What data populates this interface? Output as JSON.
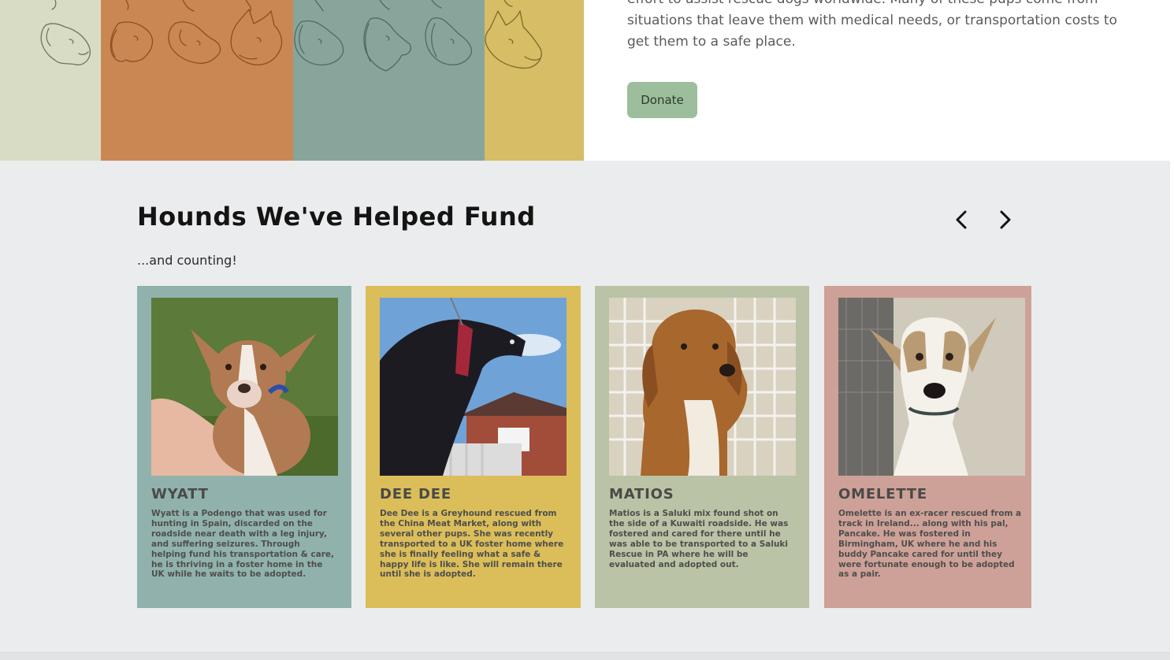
{
  "intro": {
    "text": "effort to assist rescue dogs worldwide. Many of these pups come from situations that leave them with medical needs, or transportation costs to get them to a safe place.",
    "donate_label": "Donate"
  },
  "colors": {
    "art": [
      "#d9dcc4",
      "#cb8753",
      "#88a59c",
      "#d6bd66"
    ],
    "donate": "#9dbe9c",
    "cards": [
      "#91b2ac",
      "#dbbe5a",
      "#bac3a5",
      "#cda198"
    ]
  },
  "hounds": {
    "title": "Hounds We've Helped Fund",
    "subtitle": "...and counting!",
    "prev_icon": "chevron-left-icon",
    "next_icon": "chevron-right-icon",
    "cards": [
      {
        "name": "WYATT",
        "description": "Wyatt is a Podengo that was used for hunting in Spain, discarded on the roadside near death with a leg injury, and suffering seizures. Through helping fund his transportation & care, he is thriving in a foster home in the UK while he waits to be adopted."
      },
      {
        "name": "DEE DEE",
        "description": "Dee Dee is a Greyhound rescued from the China Meat Market, along with several other pups. She was recently transported to a UK foster home where she is finally feeling what a safe & happy life is like. She will remain there until she is adopted."
      },
      {
        "name": "MATIOS",
        "description": "Matios is a Saluki mix found shot on the side of a Kuwaiti roadside. He was fostered and cared for there until he was able to be transported to a Saluki Rescue in PA where he will be evaluated and adopted out."
      },
      {
        "name": "OMELETTE",
        "description": "Omelette is an ex-racer rescued from a track in Ireland... along with his pal, Pancake. He was fostered in Birmingham, UK where he and his buddy Pancake cared for until they were fortunate enough to be adopted as a pair."
      }
    ]
  }
}
